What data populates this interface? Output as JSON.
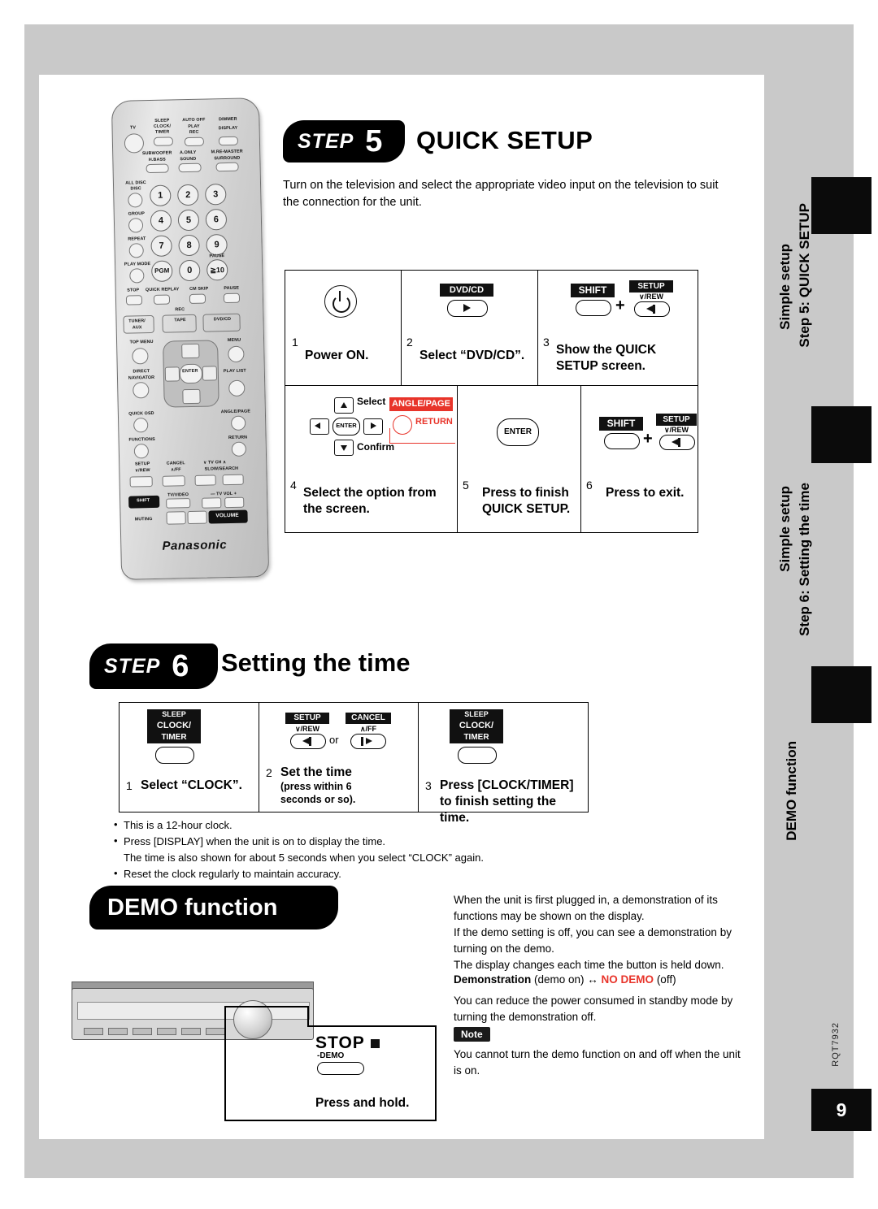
{
  "page": {
    "number": "9",
    "doc_code": "RQT7932"
  },
  "side_tabs": [
    {
      "label": "Simple setup",
      "sublabel": "Step 5: QUICK SETUP"
    },
    {
      "label": "Simple setup",
      "sublabel": "Step 6: Setting the time"
    },
    {
      "label": "DEMO function",
      "sublabel": ""
    }
  ],
  "step5": {
    "badge_word": "STEP",
    "badge_num": "5",
    "title": "QUICK SETUP",
    "intro": "Turn on the television and select the appropriate video input on the television to suit the connection for the unit.",
    "cells": [
      {
        "num": "1",
        "caption": "Power ON.",
        "key": "power"
      },
      {
        "num": "2",
        "caption": "Select “DVD/CD”.",
        "key": "DVD/CD"
      },
      {
        "num": "3",
        "caption": "Show the QUICK SETUP screen.",
        "key": "SHIFT + SETUP"
      },
      {
        "num": "4",
        "caption": "Select the option from the screen.",
        "key": "cursor"
      },
      {
        "num": "5",
        "caption": "Press to finish QUICK SETUP.",
        "key": "ENTER"
      },
      {
        "num": "6",
        "caption": "Press to exit.",
        "key": "SHIFT + SETUP"
      }
    ],
    "keys": {
      "dvdcd": "DVD/CD",
      "shift": "SHIFT",
      "setup": "SETUP",
      "setup_sub": "∨/REW",
      "plus": "+",
      "select": "Select",
      "confirm": "Confirm",
      "enter": "ENTER",
      "anglepage": "ANGLE/PAGE",
      "return": "RETURN"
    }
  },
  "step6": {
    "badge_word": "STEP",
    "badge_num": "6",
    "title": "Setting the time",
    "cells": [
      {
        "num": "1",
        "caption": "Select “CLOCK”.",
        "key_top": "SLEEP",
        "key_mid": "CLOCK/",
        "key_bot": "TIMER"
      },
      {
        "num": "2",
        "caption": "Set the time",
        "sub1": "(press within 6",
        "sub2": "seconds or so).",
        "key_left_top": "SETUP",
        "key_left_bot": "∨/REW",
        "key_right_top": "CANCEL",
        "key_right_bot": "∧/FF",
        "or": "or"
      },
      {
        "num": "3",
        "caption": "Press [CLOCK/TIMER] to finish setting the time.",
        "key_top": "SLEEP",
        "key_mid": "CLOCK/",
        "key_bot": "TIMER"
      }
    ],
    "notes": [
      "This is a 12-hour clock.",
      "Press [DISPLAY] when the unit is on to display the time.",
      "The time is also shown for about 5 seconds when you select “CLOCK” again.",
      "Reset the clock regularly to maintain accuracy."
    ]
  },
  "demo": {
    "title": "DEMO function",
    "stop_label": "STOP",
    "stop_sub": "-DEMO",
    "press_hold": "Press and hold.",
    "paragraphs": [
      "When the unit is first plugged in, a demonstration of its functions may be shown on the display.",
      "If the demo setting is off, you can see a demonstration by turning on the demo.",
      "The display changes each time the button is held down."
    ],
    "demo_line_a": "Demonstration",
    "demo_line_b": " (demo on) ↔ ",
    "demo_line_c": "NO DEMO",
    "demo_line_d": " (off)",
    "paragraph_after": "You can reduce the power consumed in standby mode by turning the demonstration off.",
    "note_label": "Note",
    "note_text": "You cannot turn the demo function on and off when the unit is on."
  },
  "remote": {
    "brand": "Panasonic",
    "labels": {
      "tv": "TV",
      "sleep": "SLEEP",
      "clock": "CLOCK/",
      "timer": "TIMER",
      "auto_off": "AUTO OFF",
      "play": "PLAY",
      "rec": "REC",
      "dimmer": "DIMMER",
      "display": "DISPLAY",
      "subwoofer": "SUBWOOFER",
      "hbass": "H.BASS",
      "aonly": "A.ONLY",
      "sound": "SOUND",
      "mre_master": "M.RE-MASTER",
      "surround": "SURROUND",
      "all_disc": "ALL DISC",
      "disc": "DISC",
      "group": "GROUP",
      "repeat": "REPEAT",
      "play_mode": "PLAY MODE",
      "pgm": "PGM",
      "ten": "≧10",
      "stop": "STOP",
      "quick_replay": "QUICK REPLAY",
      "cm_skip": "CM SKIP",
      "pause": "PAUSE",
      "rec_dot": "REC",
      "tuner": "TUNER/",
      "aux": "AUX",
      "tape": "TAPE",
      "dvdcd": "DVD/CD",
      "top_menu": "TOP MENU",
      "menu": "MENU",
      "direct": "DIRECT",
      "navigator": "NAVIGATOR",
      "play_list": "PLAY LIST",
      "enter": "ENTER",
      "quick_osd": "QUICK OSD",
      "angle_page": "ANGLE/PAGE",
      "functions": "FUNCTIONS",
      "return": "RETURN",
      "setup": "SETUP",
      "vrew": "∨/REW",
      "cancel": "CANCEL",
      "ff": "∧/FF",
      "tvch": "∨ TV CH ∧",
      "slow_search": "SLOW/SEARCH",
      "shift": "SHIFT",
      "tv_video": "TV/VIDEO",
      "tv_vol": "— TV VOL +",
      "muting": "MUTING",
      "volume": "VOLUME",
      "minus": "—",
      "plus": "+",
      "numbers": [
        "1",
        "2",
        "3",
        "4",
        "5",
        "6",
        "7",
        "8",
        "9",
        "0"
      ]
    }
  }
}
